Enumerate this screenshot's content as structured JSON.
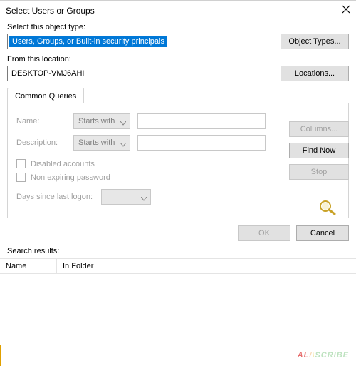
{
  "window": {
    "title": "Select Users or Groups"
  },
  "labels": {
    "object_type": "Select this object type:",
    "from_location": "From this location:",
    "search_results": "Search results:"
  },
  "fields": {
    "object_type_value": "Users, Groups, or Built-in security principals",
    "location_value": "DESKTOP-VMJ6AHI"
  },
  "buttons": {
    "object_types": "Object Types...",
    "locations": "Locations...",
    "columns": "Columns...",
    "find_now": "Find Now",
    "stop": "Stop",
    "ok": "OK",
    "cancel": "Cancel"
  },
  "tab": {
    "common": "Common Queries"
  },
  "queries": {
    "name_label": "Name:",
    "name_mode": "Starts with",
    "desc_label": "Description:",
    "desc_mode": "Starts with",
    "disabled_accounts": "Disabled accounts",
    "non_expiring": "Non expiring password",
    "days_label": "Days since last logon:"
  },
  "results": {
    "col_name": "Name",
    "col_folder": "In Folder"
  },
  "watermark": {
    "a": "A",
    "l": "L",
    "sep": "/",
    "s": "\\",
    "c": "SCRIBE"
  }
}
